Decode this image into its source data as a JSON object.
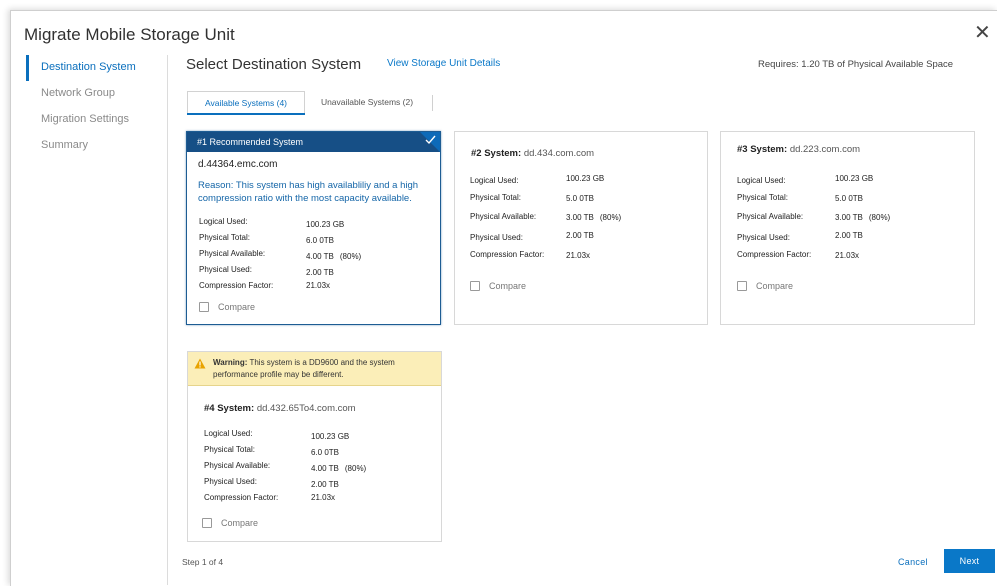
{
  "dialog": {
    "title": "Migrate Mobile Storage Unit",
    "close_glyph": "✕"
  },
  "nav": {
    "items": [
      {
        "label": "Destination System",
        "active": true
      },
      {
        "label": "Network Group",
        "active": false
      },
      {
        "label": "Migration Settings",
        "active": false
      },
      {
        "label": "Summary",
        "active": false
      }
    ]
  },
  "header": {
    "title": "Select Destination System",
    "details_link": "View Storage Unit Details",
    "requires": "Requires: 1.20 TB of Physical Available Space"
  },
  "tabs": [
    {
      "label": "Available Systems (4)",
      "active": true
    },
    {
      "label": "Unavailable Systems (2)",
      "active": false
    }
  ],
  "labels": {
    "logical_used": "Logical Used:",
    "physical_total": "Physical Total:",
    "physical_available": "Physical Available:",
    "physical_used": "Physical Used:",
    "compression_factor": "Compression Factor:",
    "compare": "Compare"
  },
  "cards": [
    {
      "banner": "#1 Recommended System",
      "host": "d.44364.emc.com",
      "reason": "Reason: This system has high availabliliy and a high compression ratio with the most capacity available.",
      "logical_used": "100.23 GB",
      "physical_total": "6.0 0TB",
      "physical_available": "4.00 TB",
      "physical_available_pct": "(80%)",
      "physical_used": "2.00 TB",
      "compression_factor": "21.03x"
    },
    {
      "title": "#2 System:",
      "host": "dd.434.com.com",
      "logical_used": "100.23 GB",
      "physical_total": "5.0 0TB",
      "physical_available": "3.00 TB",
      "physical_available_pct": "(80%)",
      "physical_used": "2.00 TB",
      "compression_factor": "21.03x"
    },
    {
      "title": "#3 System:",
      "host": "dd.223.com.com",
      "logical_used": "100.23 GB",
      "physical_total": "5.0 0TB",
      "physical_available": "3.00 TB",
      "physical_available_pct": "(80%)",
      "physical_used": "2.00 TB",
      "compression_factor": "21.03x"
    },
    {
      "warning_bold": "Warning:",
      "warning_text": " This system is a DD9600 and the system performance profile may be different.",
      "title": "#4 System:",
      "host": "dd.432.65To4.com.com",
      "logical_used": "100.23 GB",
      "physical_total": "6.0 0TB",
      "physical_available": "4.00 TB",
      "physical_available_pct": "(80%)",
      "physical_used": "2.00 TB",
      "compression_factor": "21.03x"
    }
  ],
  "footer": {
    "step": "Step 1 of 4",
    "cancel": "Cancel",
    "next": "Next"
  },
  "colors": {
    "accent": "#0a78c8",
    "banner": "#164f86",
    "warning_bg": "#fbeeb8"
  }
}
